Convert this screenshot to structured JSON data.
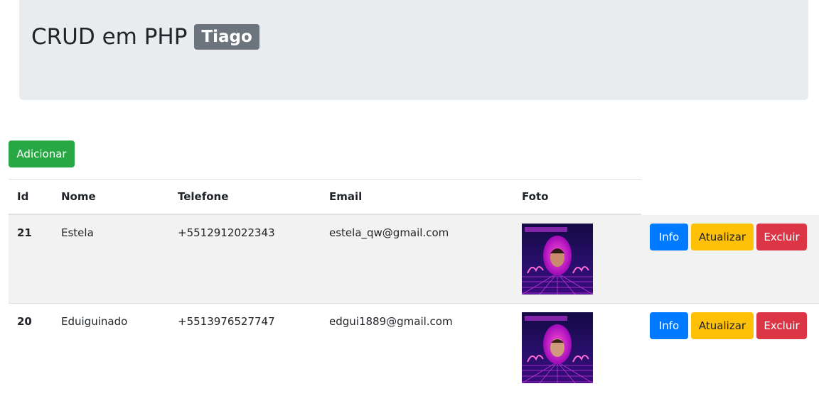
{
  "header": {
    "title": "CRUD em PHP",
    "badge": "Tiago"
  },
  "toolbar": {
    "add_label": "Adicionar"
  },
  "table": {
    "columns": [
      "Id",
      "Nome",
      "Telefone",
      "Email",
      "Foto"
    ],
    "rows": [
      {
        "id": "21",
        "nome": "Estela",
        "telefone": "+5512912022343",
        "email": "estela_qw@gmail.com",
        "photo_icon": "user-photo"
      },
      {
        "id": "20",
        "nome": "Eduiguinado",
        "telefone": "+5513976527747",
        "email": "edgui1889@gmail.com",
        "photo_icon": "user-photo"
      }
    ],
    "actions": {
      "info": "Info",
      "update": "Atualizar",
      "delete": "Excluir"
    }
  },
  "colors": {
    "success": "#28a745",
    "info": "#007bff",
    "warning": "#ffc107",
    "danger": "#dc3545",
    "badge": "#6c757d",
    "jumbotron": "#e9ecef"
  }
}
